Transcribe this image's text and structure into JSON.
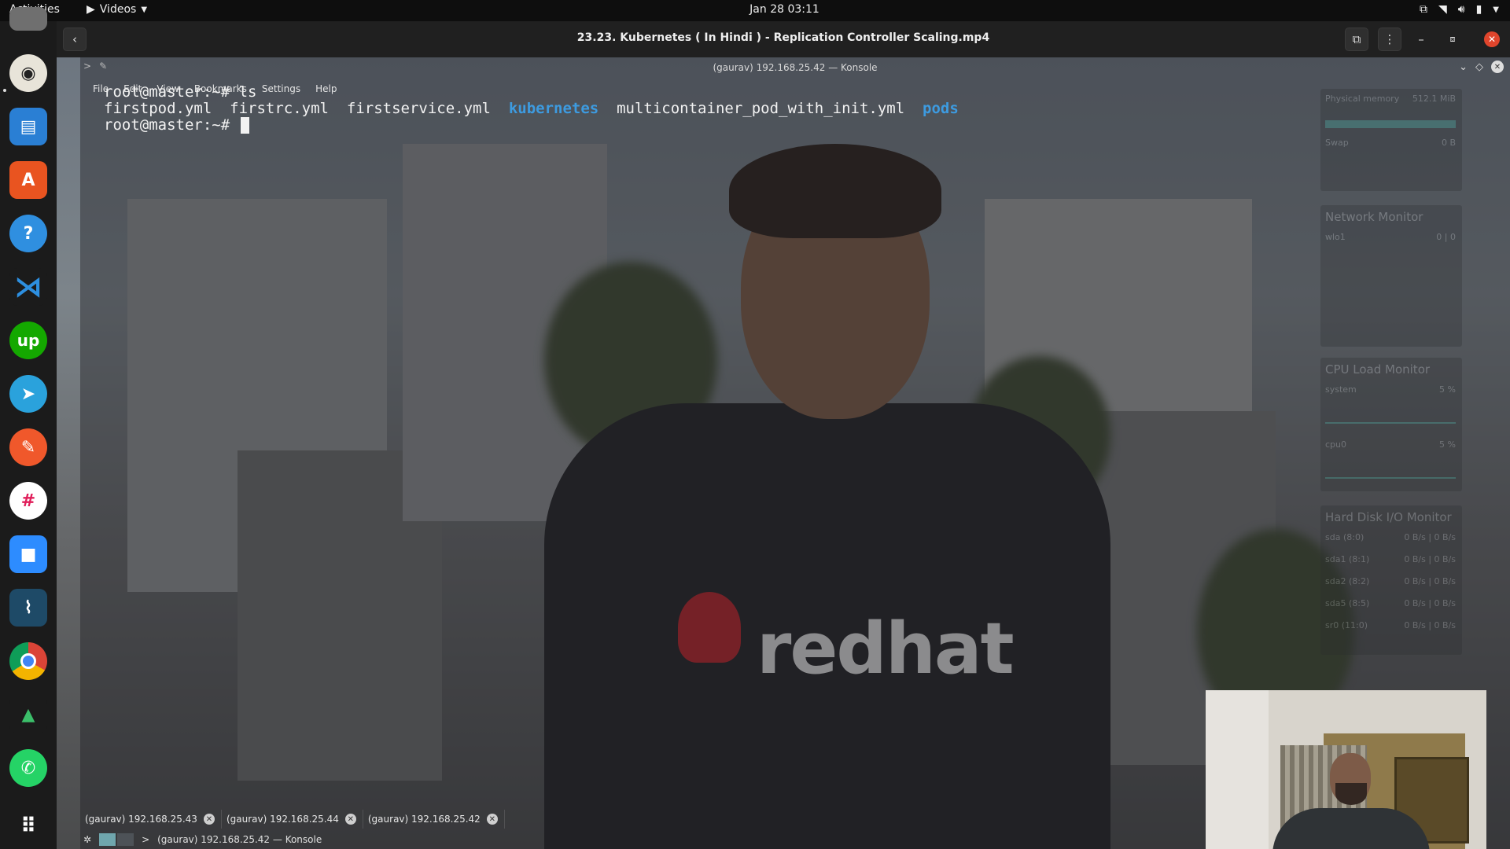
{
  "topbar": {
    "activities": "Activities",
    "app_name": "Videos",
    "clock": "Jan 28  03:11"
  },
  "player": {
    "title": "23.23. Kubernetes ( In Hindi ) - Replication Controller Scaling.mp4"
  },
  "konsole": {
    "title": "(gaurav) 192.168.25.42 — Konsole",
    "menu": [
      "File",
      "Edit",
      "View",
      "Bookmarks",
      "Settings",
      "Help"
    ],
    "terminal": {
      "prompt": "root@master:~# ",
      "command": "ls",
      "files": [
        "firstpod.yml",
        "firstrc.yml",
        "firstservice.yml",
        "kubernetes",
        "multicontainer_pod_with_init.yml",
        "pods"
      ]
    },
    "tabs": [
      "(gaurav) 192.168.25.43",
      "(gaurav) 192.168.25.44",
      "(gaurav) 192.168.25.42"
    ],
    "taskbar_label": "(gaurav) 192.168.25.42 — Konsole"
  },
  "sysmon": {
    "memory_label": "Physical memory",
    "memory_value": "512.1 MiB",
    "swap_label": "Swap",
    "swap_value": "0 B",
    "network_title": "Network Monitor",
    "network_iface": "wlo1",
    "network_value": "0 | 0",
    "cpu_title": "CPU Load Monitor",
    "cpu_system_label": "system",
    "cpu_system_value": "5 %",
    "cpu0_label": "cpu0",
    "cpu0_value": "5 %",
    "disk_title": "Hard Disk I/O Monitor",
    "disks": [
      {
        "name": "sda (8:0)",
        "value": "0 B/s | 0 B/s"
      },
      {
        "name": "sda1 (8:1)",
        "value": "0 B/s | 0 B/s"
      },
      {
        "name": "sda2 (8:2)",
        "value": "0 B/s | 0 B/s"
      },
      {
        "name": "sda5 (8:5)",
        "value": "0 B/s | 0 B/s"
      },
      {
        "name": "sr0 (11:0)",
        "value": "0 B/s | 0 B/s"
      }
    ]
  },
  "video_logo": "redhat",
  "colors": {
    "dir_blue": "#3d9be0",
    "close_red": "#e0452c",
    "accent_teal": "#3bb6a8"
  }
}
